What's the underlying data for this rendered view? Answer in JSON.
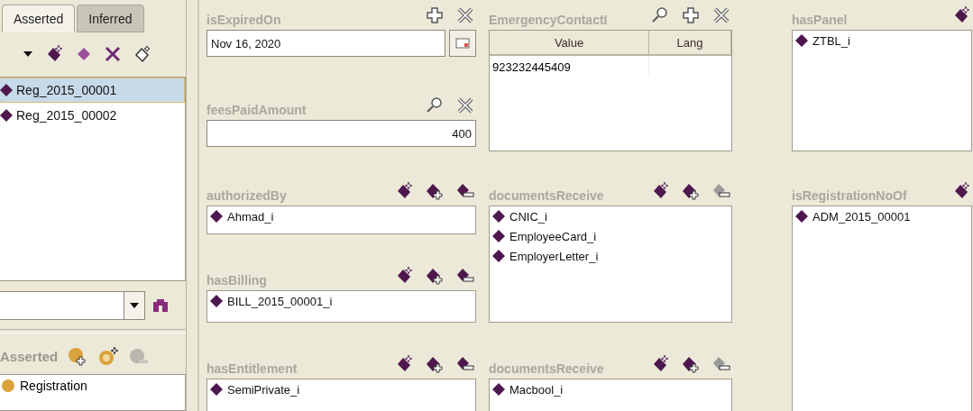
{
  "left_panel": {
    "tabs": [
      {
        "label": "Asserted",
        "selected": true
      },
      {
        "label": "Inferred",
        "selected": false
      }
    ],
    "individuals": [
      {
        "label": "Reg_2015_00001",
        "selected": true
      },
      {
        "label": "Reg_2015_00002",
        "selected": false
      }
    ],
    "types": {
      "label": "Asserted",
      "items": [
        "Registration"
      ]
    }
  },
  "columns": [
    [
      {
        "label": "isExpiredOn",
        "kind": "date",
        "value": "Nov 16, 2020"
      },
      {
        "label": "feesPaidAmount",
        "kind": "number",
        "value": "400"
      },
      {
        "label": "authorizedBy",
        "kind": "objects",
        "remove_disabled": false,
        "items": [
          "Ahmad_i"
        ]
      },
      {
        "label": "hasBilling",
        "kind": "objects",
        "remove_disabled": false,
        "items": [
          "BILL_2015_00001_i"
        ]
      },
      {
        "label": "hasEntitlement",
        "kind": "objects",
        "remove_disabled": false,
        "items": [
          "SemiPrivate_i"
        ]
      }
    ],
    [
      {
        "label": "EmergencyContactI",
        "kind": "table",
        "columns": [
          "Value",
          "Lang"
        ],
        "rows": [
          [
            "923232445409"
          ]
        ]
      },
      {
        "label": "documentsReceive",
        "kind": "objects",
        "remove_disabled": true,
        "items": [
          "CNIC_i",
          "EmployeeCard_i",
          "EmployerLetter_i"
        ]
      },
      {
        "label": "documentsReceive",
        "kind": "objects",
        "remove_disabled": true,
        "items": [
          "Macbool_i"
        ]
      }
    ],
    [
      {
        "label": "hasPanel",
        "kind": "objects",
        "items": [
          "ZTBL_i"
        ]
      },
      {
        "label": "isRegistrationNoOf",
        "kind": "objects",
        "items": [
          "ADM_2015_00001"
        ]
      }
    ]
  ]
}
